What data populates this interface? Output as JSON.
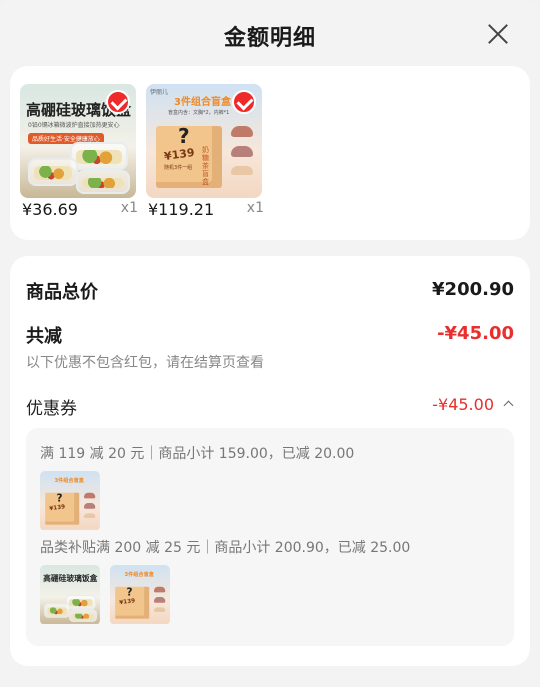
{
  "header": {
    "title": "金额明细",
    "close_icon": "close-icon"
  },
  "products": [
    {
      "name": "glass-bowl",
      "thumb_title": "高硼硅玻璃饭盒",
      "thumb_sub": "0铅0镉冰箱微波炉直接加热更安心",
      "thumb_tag": "品质好生活·安全健康放心",
      "price": "¥36.69",
      "qty": "x1",
      "selected": true
    },
    {
      "name": "blind-box",
      "thumb_brand": "伊丽儿",
      "thumb_title": "3件组合盲盒",
      "thumb_sub": "盲盒内含：文胸*2，内裤*1",
      "thumb_price": "¥139",
      "thumb_line": "随机3件一组",
      "thumb_side": "奶糖茶盲盒",
      "price": "¥119.21",
      "qty": "x1",
      "selected": true
    }
  ],
  "summary": {
    "total_label": "商品总价",
    "total_value": "¥200.90",
    "discount_label": "共减",
    "discount_value": "-¥45.00",
    "note": "以下优惠不包含红包，请在结算页查看",
    "coupon_label": "优惠券",
    "coupon_value": "-¥45.00"
  },
  "coupon_rules": [
    {
      "text": "满 119 减 20 元｜商品小计 159.00，已减 20.00",
      "items": [
        "blind-box"
      ]
    },
    {
      "text": "品类补贴满 200 减 25 元｜商品小计 200.90，已减 25.00",
      "items": [
        "glass-bowl",
        "blind-box"
      ]
    }
  ],
  "colors": {
    "accent_red": "#ea2d2d",
    "check_red": "#ee2a2a",
    "background": "#f3f3f3"
  }
}
